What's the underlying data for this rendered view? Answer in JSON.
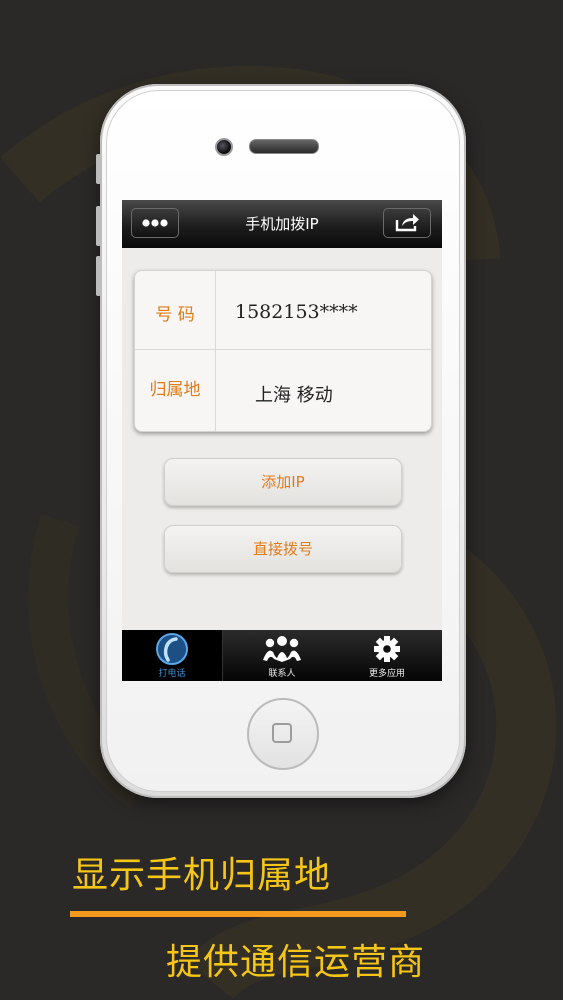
{
  "app": {
    "title": "手机加拨IP",
    "nav_left_icon": "more-icon",
    "nav_right_icon": "share-icon"
  },
  "info": {
    "number_label": "号 码",
    "number_value": "1582153****",
    "location_label": "归属地",
    "location_value": "上海 移动"
  },
  "actions": {
    "add_ip": "添加IP",
    "direct_dial": "直接拨号"
  },
  "tabs": [
    {
      "label": "打电话",
      "icon": "phone-circle-icon",
      "active": true
    },
    {
      "label": "联系人",
      "icon": "people-icon",
      "active": false
    },
    {
      "label": "更多应用",
      "icon": "gear-icon",
      "active": false
    }
  ],
  "promo": {
    "line1": "显示手机归属地",
    "line2": "提供通信运营商"
  },
  "colors": {
    "accent_orange": "#e07b1a",
    "promo_yellow": "#f5c518",
    "divider_orange": "#f39a1e",
    "active_tab_blue": "#3b8fd6"
  }
}
